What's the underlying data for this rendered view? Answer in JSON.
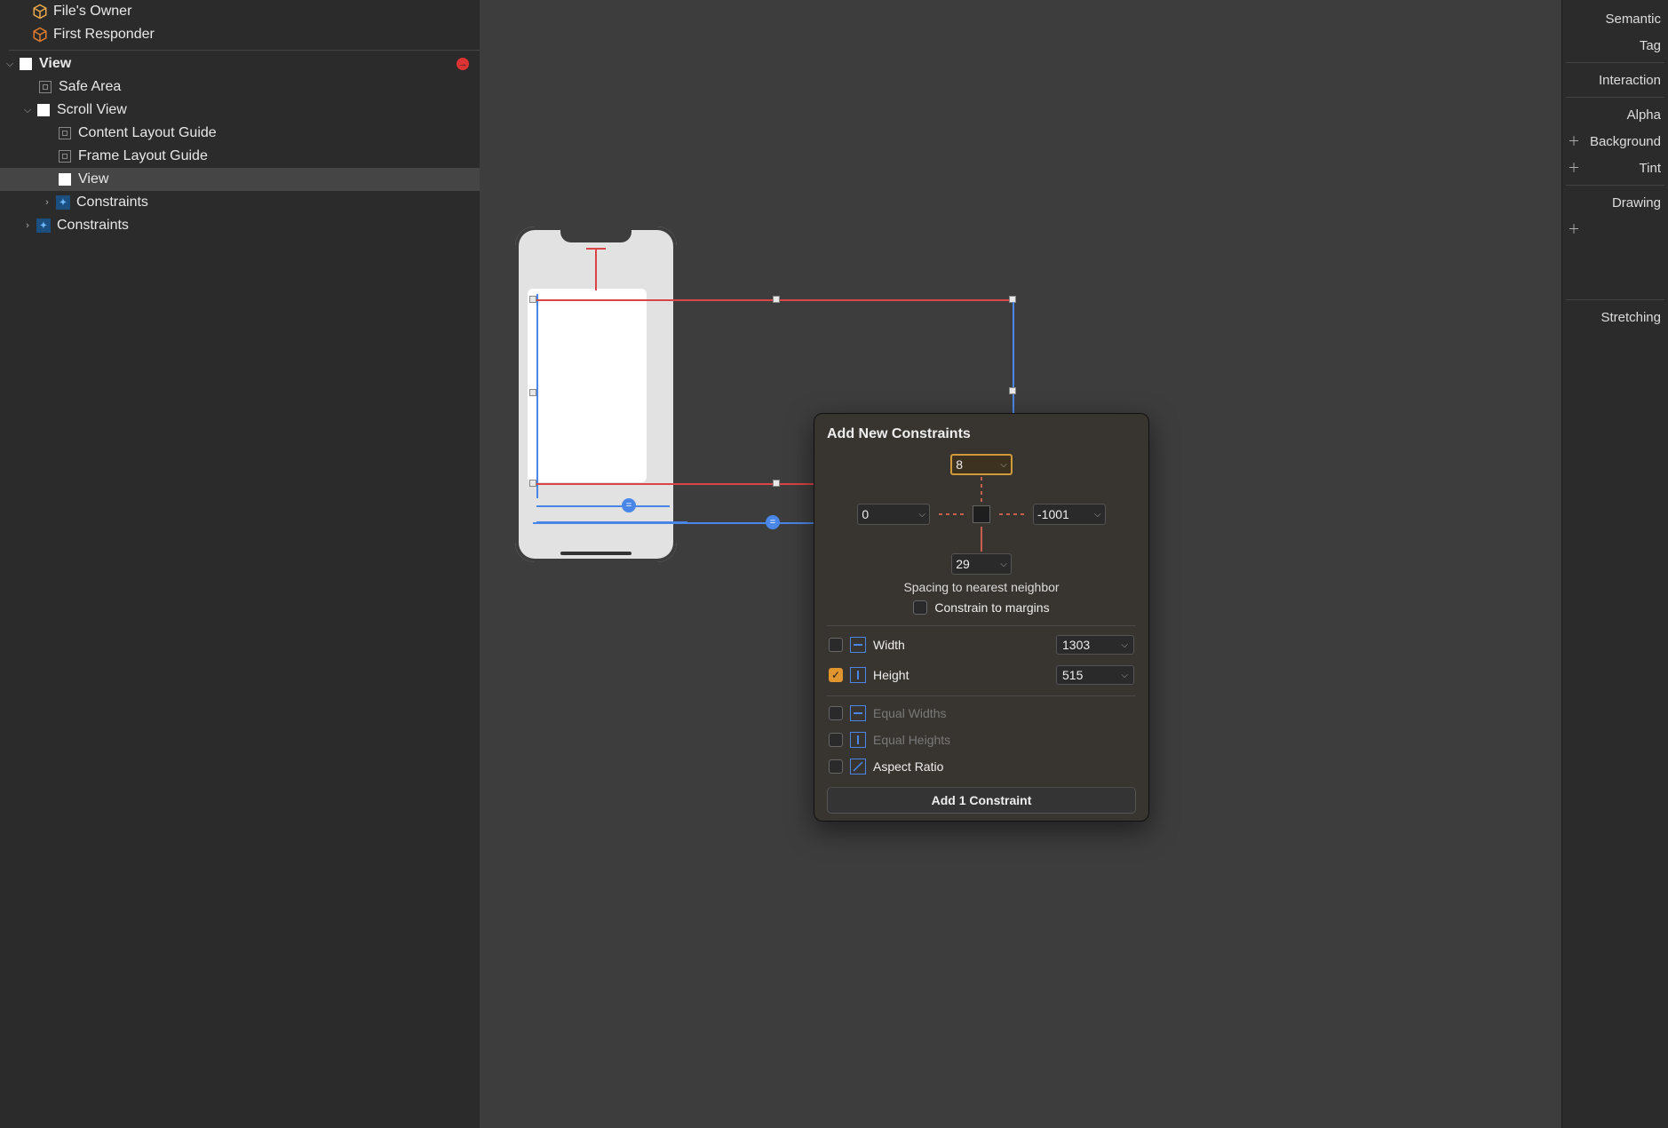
{
  "outline": {
    "files_owner": "File's Owner",
    "first_responder": "First Responder",
    "view": "View",
    "safe_area": "Safe Area",
    "scroll_view": "Scroll View",
    "content_guide": "Content Layout Guide",
    "frame_guide": "Frame Layout Guide",
    "inner_view": "View",
    "constraints_inner": "Constraints",
    "constraints_outer": "Constraints"
  },
  "inspector": {
    "semantic": "Semantic",
    "tag": "Tag",
    "interaction": "Interaction",
    "alpha": "Alpha",
    "background": "Background",
    "tint": "Tint",
    "drawing": "Drawing",
    "stretching": "Stretching"
  },
  "popover": {
    "title": "Add New Constraints",
    "top": "8",
    "left": "0",
    "right": "-1001",
    "bottom": "29",
    "spacing_caption": "Spacing to nearest neighbor",
    "constrain_margins": "Constrain to margins",
    "width_label": "Width",
    "width_value": "1303",
    "height_label": "Height",
    "height_value": "515",
    "equal_widths": "Equal Widths",
    "equal_heights": "Equal Heights",
    "aspect_ratio": "Aspect Ratio",
    "apply": "Add 1 Constraint"
  }
}
